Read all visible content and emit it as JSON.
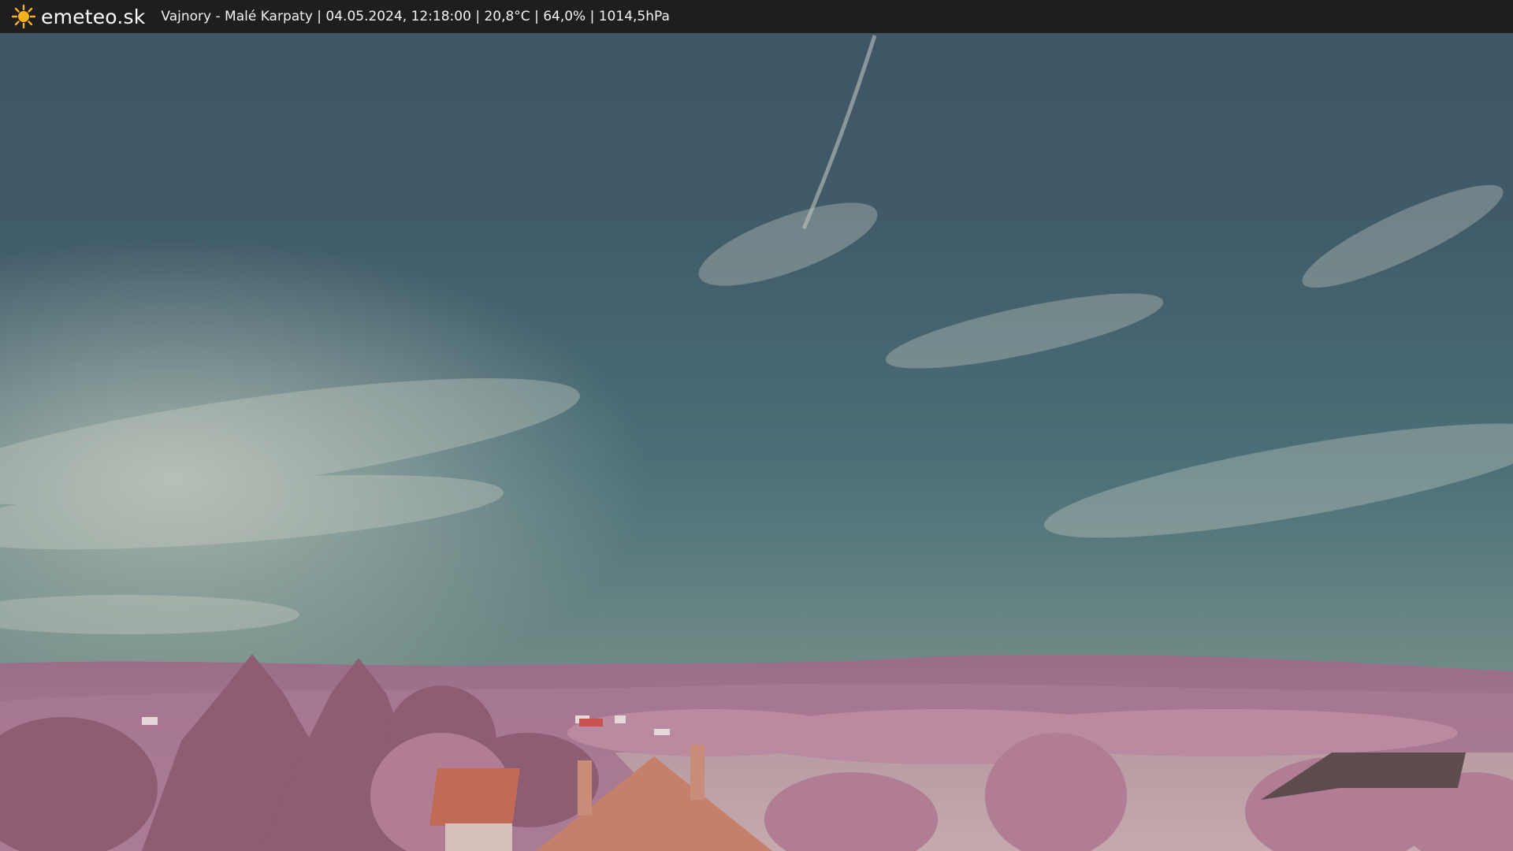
{
  "overlay": {
    "brand": "emeteo.sk",
    "info": "Vajnory - Malé Karpaty | 04.05.2024, 12:18:00 | 20,8°C | 64,0% | 1014,5hPa",
    "icon": "sun-icon",
    "bar_color": "#1e1e1e",
    "sun_color": "#f6b21a"
  }
}
